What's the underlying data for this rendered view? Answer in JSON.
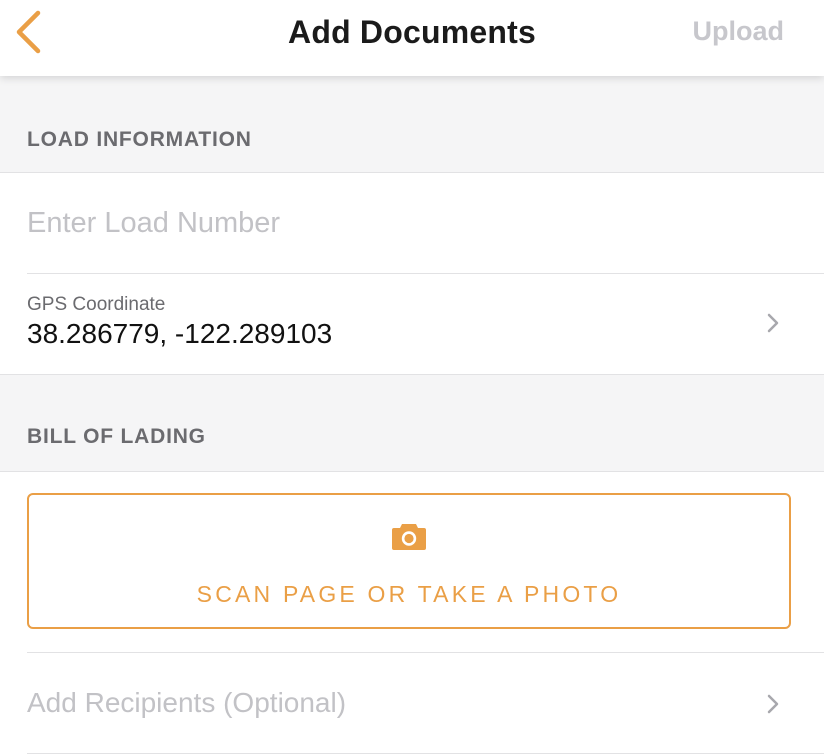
{
  "nav": {
    "title": "Add Documents",
    "upload_label": "Upload",
    "back_icon": "chevron-left-icon"
  },
  "load_section": {
    "header": "LOAD INFORMATION",
    "load_number": {
      "placeholder": "Enter Load Number",
      "value": ""
    },
    "gps": {
      "label": "GPS Coordinate",
      "value": "38.286779, -122.289103"
    }
  },
  "bol_section": {
    "header": "BILL OF LADING",
    "scan_label": "SCAN PAGE OR TAKE A PHOTO",
    "scan_icon": "camera-icon"
  },
  "recipients": {
    "label": "Add Recipients (Optional)"
  },
  "colors": {
    "accent": "#ea9f46",
    "disabled": "#c7c7cc",
    "section_bg": "#f5f5f6",
    "separator": "#e2e2e4"
  }
}
